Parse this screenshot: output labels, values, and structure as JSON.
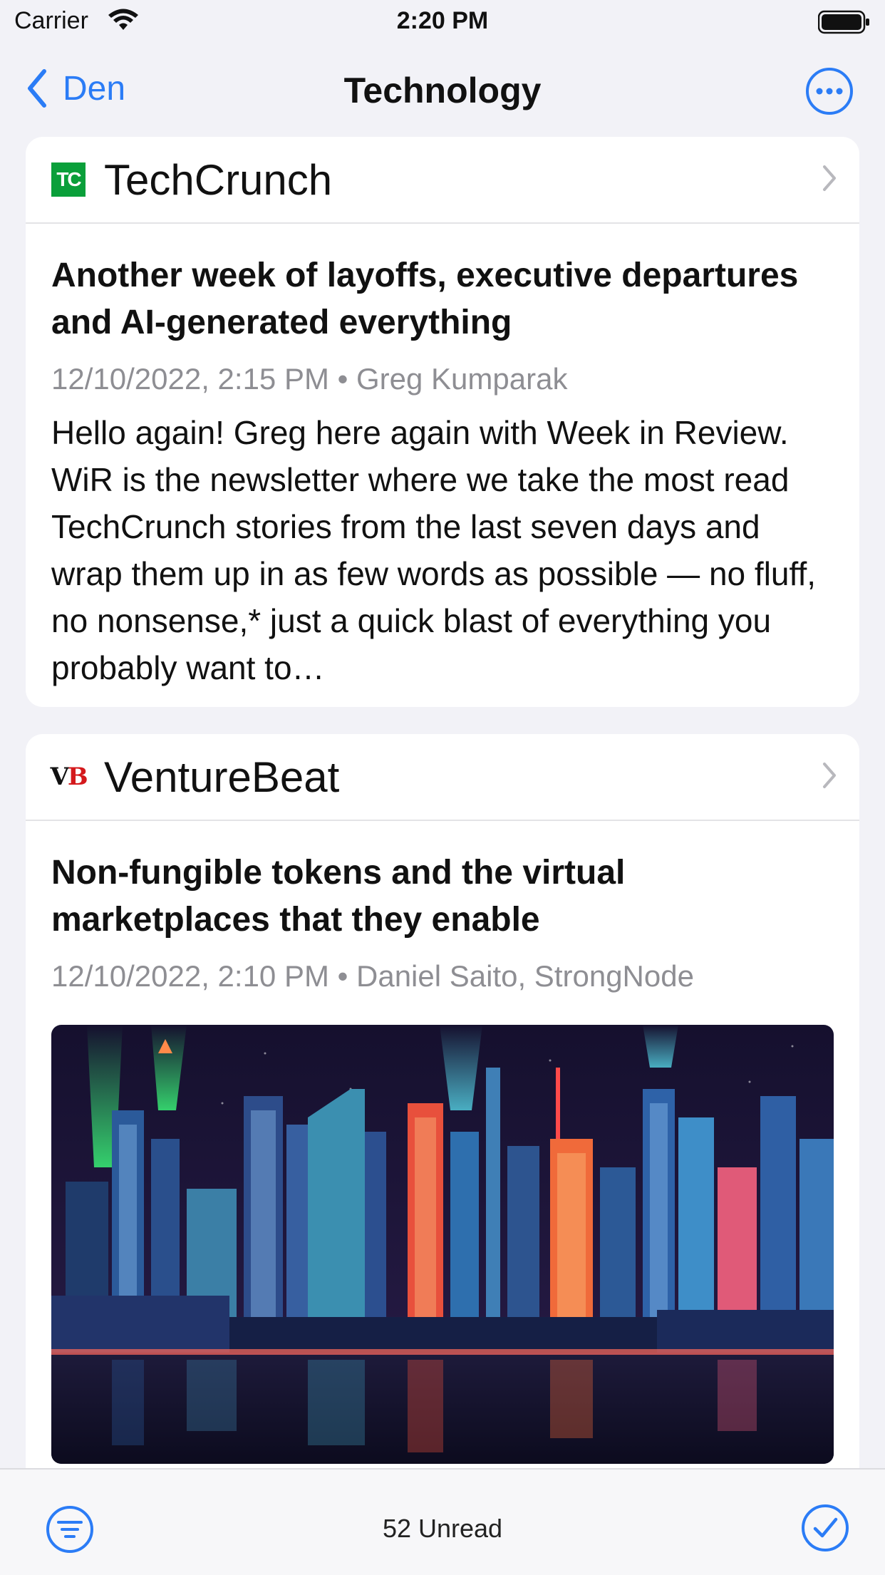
{
  "status_bar": {
    "carrier": "Carrier",
    "time": "2:20 PM"
  },
  "nav": {
    "back_label": "Den",
    "title": "Technology"
  },
  "colors": {
    "accent": "#2b7cf6",
    "meta_gray": "#8e8e93",
    "techcrunch_green": "#0a9f3a",
    "venturebeat_red": "#d4191c"
  },
  "cards": [
    {
      "source": "TechCrunch",
      "logo_text": "TC",
      "headline": "Another week of layoffs, executive departures and AI-generated everything",
      "meta": "12/10/2022, 2:15 PM • Greg Kumparak",
      "summary": "Hello again! Greg here again with Week in Review. WiR is the newsletter where we take the most read TechCrunch stories from the last seven days and wrap them up in as few words as possible — no fluff, no nonsense,* just a quick blast of everything you probably want to…"
    },
    {
      "source": "VentureBeat",
      "logo_text_v": "V",
      "logo_text_b": "B",
      "headline": "Non-fungible tokens and the virtual marketplaces that they enable",
      "meta": "12/10/2022, 2:10 PM • Daniel Saito, StrongNode"
    }
  ],
  "toolbar": {
    "unread": "52 Unread"
  },
  "icons": {
    "back": "chevron-left-icon",
    "more": "ellipsis-circle-icon",
    "filter": "filter-circle-icon",
    "mark_read": "checkmark-circle-icon"
  }
}
